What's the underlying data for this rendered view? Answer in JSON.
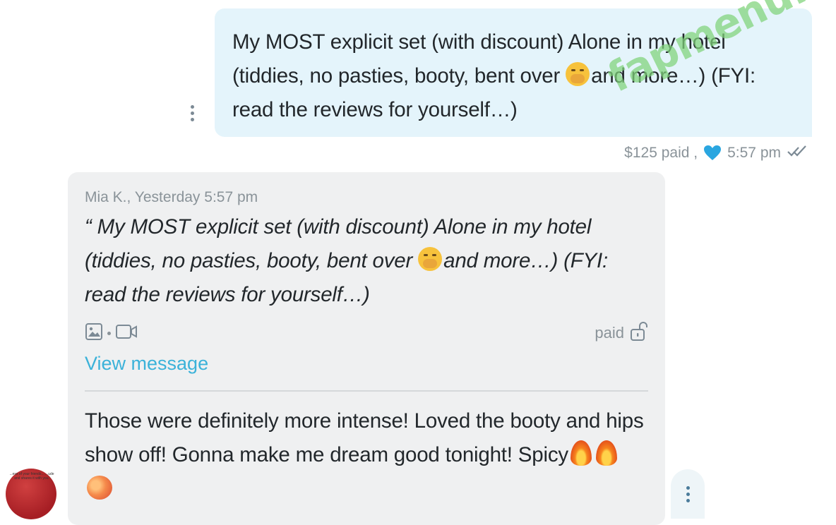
{
  "sent_message": {
    "text_part1": "My MOST explicit set (with discount) Alone in my hotel (tiddies, no pasties, booty, bent over ",
    "text_part2": "and more…) (FYI: read the reviews for yourself…)",
    "price_status": "$125 paid ,",
    "time": "5:57 pm"
  },
  "watermark": "fapmenu.com",
  "received_message": {
    "quote_meta": "Mia K., Yesterday 5:57 pm",
    "quote_part1": "“ My MOST explicit set (with discount) Alone in my hotel (tiddies, no pasties, booty, bent over ",
    "quote_part2": "and more…) (FYI: read the reviews for yourself…)",
    "paid_label": "paid",
    "view_message_label": "View message",
    "reply_text": "Those were definitely more intense! Loved the booty and hips show off! Gonna make me dream good tonight! Spicy"
  },
  "avatar_caption": "...ess of your friends... ...ude and shares it with you.",
  "icons": {
    "more_sent": "more-vertical-icon",
    "heart": "heart-icon",
    "read_receipt": "double-check-icon",
    "image": "image-icon",
    "video": "video-icon",
    "unlock": "unlock-icon",
    "more_received": "more-vertical-icon"
  },
  "colors": {
    "sent_bubble": "#e4f4fb",
    "received_bubble": "#eff0f1",
    "link": "#3bb2d9",
    "heart": "#2aa6e0",
    "watermark": "#7fd37a"
  }
}
